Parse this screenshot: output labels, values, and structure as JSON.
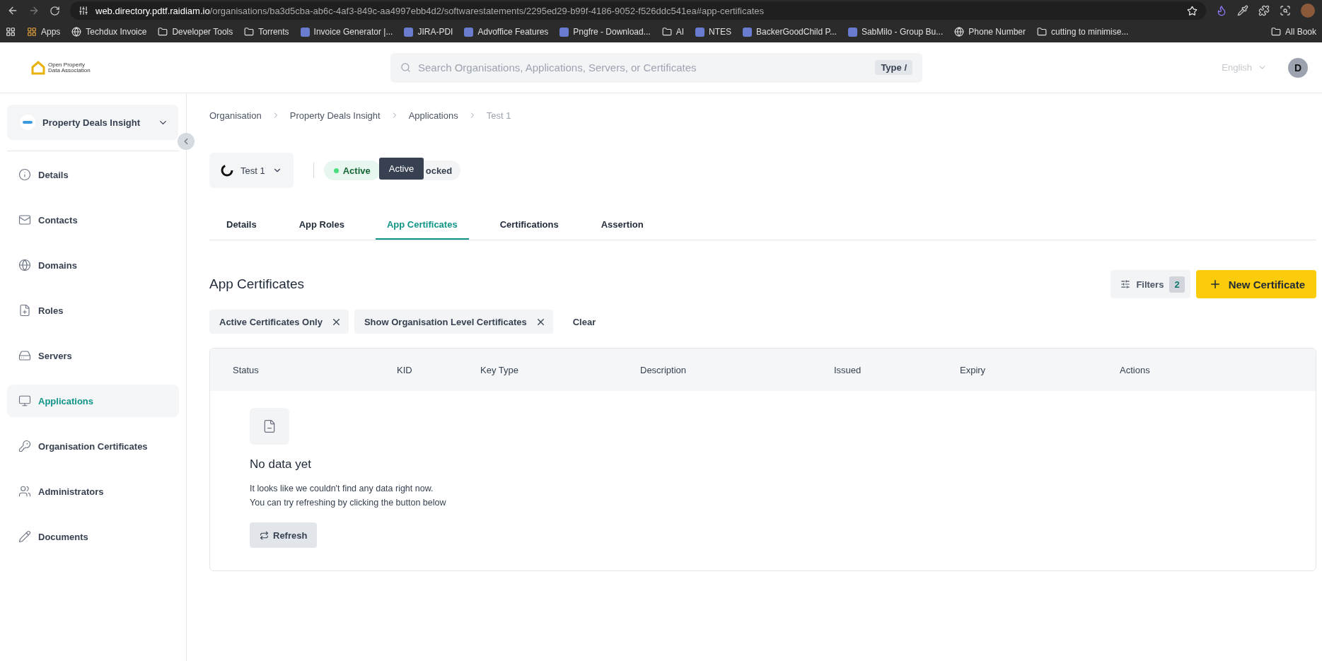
{
  "browser": {
    "url_host": "web.directory.pdtf.raidiam.io",
    "url_path": "/organisations/ba3d5cba-ab6c-4af3-849c-aa4997ebb4d2/softwarestatements/2295ed29-b99f-4186-9052-f526ddc541ea#app-certificates",
    "bookmarks": [
      {
        "kind": "apps",
        "label": "Apps"
      },
      {
        "kind": "globe",
        "label": "Techdux Invoice"
      },
      {
        "kind": "folder",
        "label": "Developer Tools"
      },
      {
        "kind": "folder",
        "label": "Torrents"
      },
      {
        "kind": "site",
        "label": "Invoice Generator |..."
      },
      {
        "kind": "site",
        "label": "JIRA-PDI"
      },
      {
        "kind": "site",
        "label": "Advoffice Features"
      },
      {
        "kind": "site",
        "label": "Pngfre - Download..."
      },
      {
        "kind": "folder",
        "label": "AI"
      },
      {
        "kind": "site",
        "label": "NTES"
      },
      {
        "kind": "site",
        "label": "BackerGoodChild P..."
      },
      {
        "kind": "site",
        "label": "SabMilo - Group Bu..."
      },
      {
        "kind": "globe",
        "label": "Phone Number"
      },
      {
        "kind": "folder",
        "label": "cutting to minimise..."
      }
    ],
    "all_bookmarks": "All Book"
  },
  "header": {
    "logo_line1": "Open Property",
    "logo_line2": "Data Association",
    "search": {
      "placeholder": "Search Organisations, Applications, Servers, or Certificates",
      "shortcut": "Type /"
    },
    "language": "English",
    "avatar": "D"
  },
  "sidebar": {
    "organisation": "Property Deals Insight",
    "items": [
      {
        "kind": "info",
        "label": "Details",
        "selected": false
      },
      {
        "kind": "mail",
        "label": "Contacts",
        "selected": false
      },
      {
        "kind": "globe",
        "label": "Domains",
        "selected": false
      },
      {
        "kind": "file",
        "label": "Roles",
        "selected": false
      },
      {
        "kind": "server",
        "label": "Servers",
        "selected": false
      },
      {
        "kind": "monitor",
        "label": "Applications",
        "selected": true
      },
      {
        "kind": "key",
        "label": "Organisation Certificates",
        "selected": false
      },
      {
        "kind": "users",
        "label": "Administrators",
        "selected": false
      },
      {
        "kind": "pencil",
        "label": "Documents",
        "selected": false
      }
    ]
  },
  "breadcrumb": [
    {
      "label": "Organisation",
      "current": false
    },
    {
      "label": "Property Deals Insight",
      "current": false
    },
    {
      "label": "Applications",
      "current": false
    },
    {
      "label": "Test 1",
      "current": true
    }
  ],
  "application": {
    "name": "Test 1",
    "status_badges": [
      {
        "label": "Active",
        "kind": "active"
      },
      {
        "label": "ocked",
        "kind": "plain"
      }
    ],
    "tooltip": "Active"
  },
  "tabs": [
    {
      "label": "Details",
      "selected": false
    },
    {
      "label": "App Roles",
      "selected": false
    },
    {
      "label": "App Certificates",
      "selected": true
    },
    {
      "label": "Certifications",
      "selected": false
    },
    {
      "label": "Assertion",
      "selected": false
    }
  ],
  "section": {
    "title": "App Certificates",
    "filters_button": "Filters",
    "filters_count": "2",
    "new_button": "New Certificate",
    "chips": [
      "Active Certificates Only",
      "Show Organisation Level Certificates"
    ],
    "clear": "Clear"
  },
  "table": {
    "columns": [
      "Status",
      "KID",
      "Key Type",
      "Description",
      "Issued",
      "Expiry",
      "Actions"
    ],
    "empty": {
      "title": "No data yet",
      "line1": "It looks like we couldn't find any data right now.",
      "line2": "You can try refreshing by clicking the button below",
      "button": "Refresh"
    }
  }
}
